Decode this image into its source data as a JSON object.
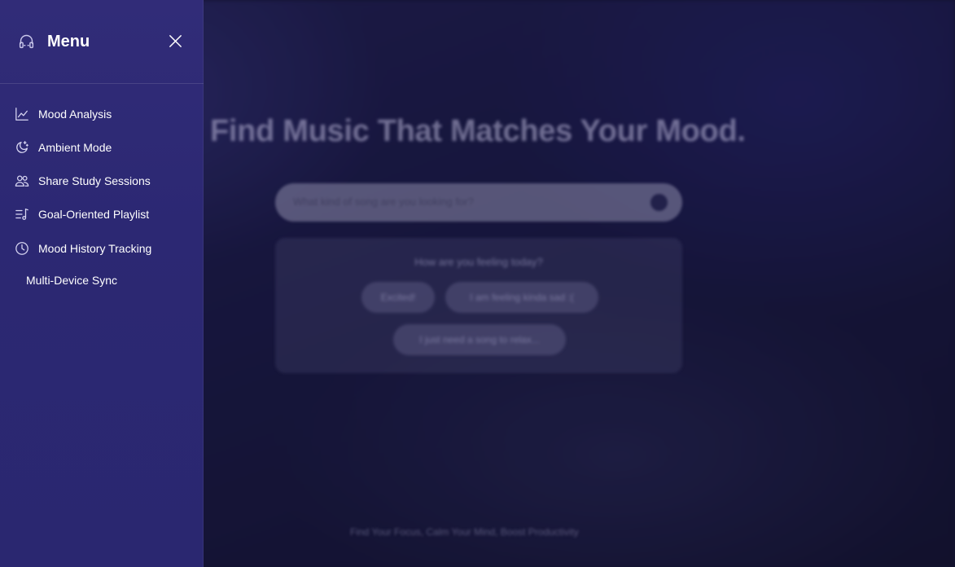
{
  "background": {
    "headline": "Find Music That Matches Your Mood.",
    "search_placeholder": "What kind of song are you looking for?",
    "mood_question": "How are you feeling today?",
    "mood_chips": [
      "Excited!",
      "I am feeling kinda sad :(",
      "I just need a song to relax..."
    ],
    "footer_tagline": "Find Your Focus, Calm Your Mind, Boost Productivity"
  },
  "sidebar": {
    "title": "Menu",
    "logo_icon": "headphones-icon",
    "close_icon": "close-icon",
    "items": [
      {
        "label": "Mood Analysis",
        "icon": "chart-line-icon"
      },
      {
        "label": "Ambient Mode",
        "icon": "moon-stars-icon"
      },
      {
        "label": "Share Study Sessions",
        "icon": "users-icon"
      },
      {
        "label": "Goal-Oriented Playlist",
        "icon": "playlist-icon"
      },
      {
        "label": "Mood History Tracking",
        "icon": "clock-icon"
      },
      {
        "label": "Multi-Device Sync",
        "icon": ""
      }
    ]
  },
  "colors": {
    "sidebar_bg": "#2c2873",
    "page_bg": "#171637",
    "text": "#ffffff"
  }
}
